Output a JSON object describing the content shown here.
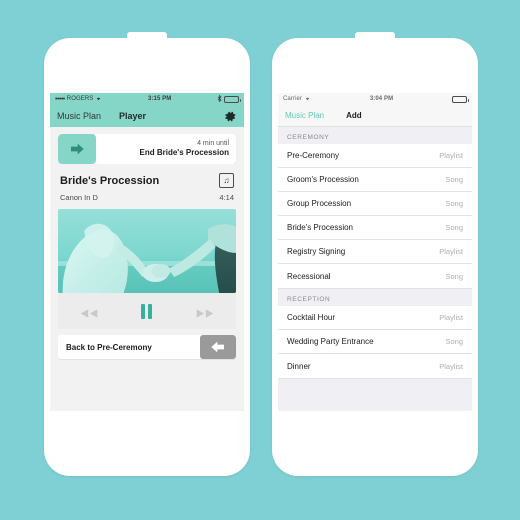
{
  "theme": {
    "background": "#7fd0d4",
    "accent_teal": "#85d6c6",
    "accent_teal_dark": "#39b09c",
    "link_teal": "#62cbb6",
    "list_bg": "#efeff4",
    "gray_button": "#9a9a9a"
  },
  "left_phone": {
    "status_bar": {
      "signal_dots": "•••••",
      "carrier": "ROGERS",
      "wifi_icon": "wifi-icon",
      "time": "3:15 PM",
      "bluetooth_icon": "bluetooth-icon",
      "battery_icon": "battery-icon"
    },
    "nav": {
      "back_label": "Music Plan",
      "title": "Player",
      "settings_icon": "gear-icon"
    },
    "up_next": {
      "arrow_icon": "arrow-right-icon",
      "time_until": "4 min until",
      "event": "End Bride's Procession"
    },
    "now_playing": {
      "title": "Bride's Procession",
      "queue_icon": "music-note-square-icon",
      "artist": "Canon In D",
      "duration": "4:14",
      "artwork_alt": "wedding-couple-holding-hands-photo"
    },
    "controls": {
      "previous_icon": "rewind-icon",
      "pause_icon": "pause-icon",
      "next_icon": "fast-forward-icon"
    },
    "bottom_bar": {
      "label": "Back to Pre-Ceremony",
      "back_icon": "arrow-left-icon"
    }
  },
  "right_phone": {
    "status_bar": {
      "carrier": "Carrier",
      "wifi_icon": "wifi-icon",
      "time": "3:04 PM",
      "battery_icon": "battery-icon"
    },
    "nav": {
      "back_label": "Music Plan",
      "title": "Add"
    },
    "sections": [
      {
        "header": "CEREMONY",
        "rows": [
          {
            "title": "Pre-Ceremony",
            "kind": "Playlist"
          },
          {
            "title": "Groom's Procession",
            "kind": "Song"
          },
          {
            "title": "Group Procession",
            "kind": "Song"
          },
          {
            "title": "Bride's Procession",
            "kind": "Song"
          },
          {
            "title": "Registry Signing",
            "kind": "Playlist"
          },
          {
            "title": "Recessional",
            "kind": "Song"
          }
        ]
      },
      {
        "header": "RECEPTION",
        "rows": [
          {
            "title": "Cocktail Hour",
            "kind": "Playlist"
          },
          {
            "title": "Wedding Party Entrance",
            "kind": "Song"
          },
          {
            "title": "Dinner",
            "kind": "Playlist"
          }
        ]
      }
    ]
  }
}
